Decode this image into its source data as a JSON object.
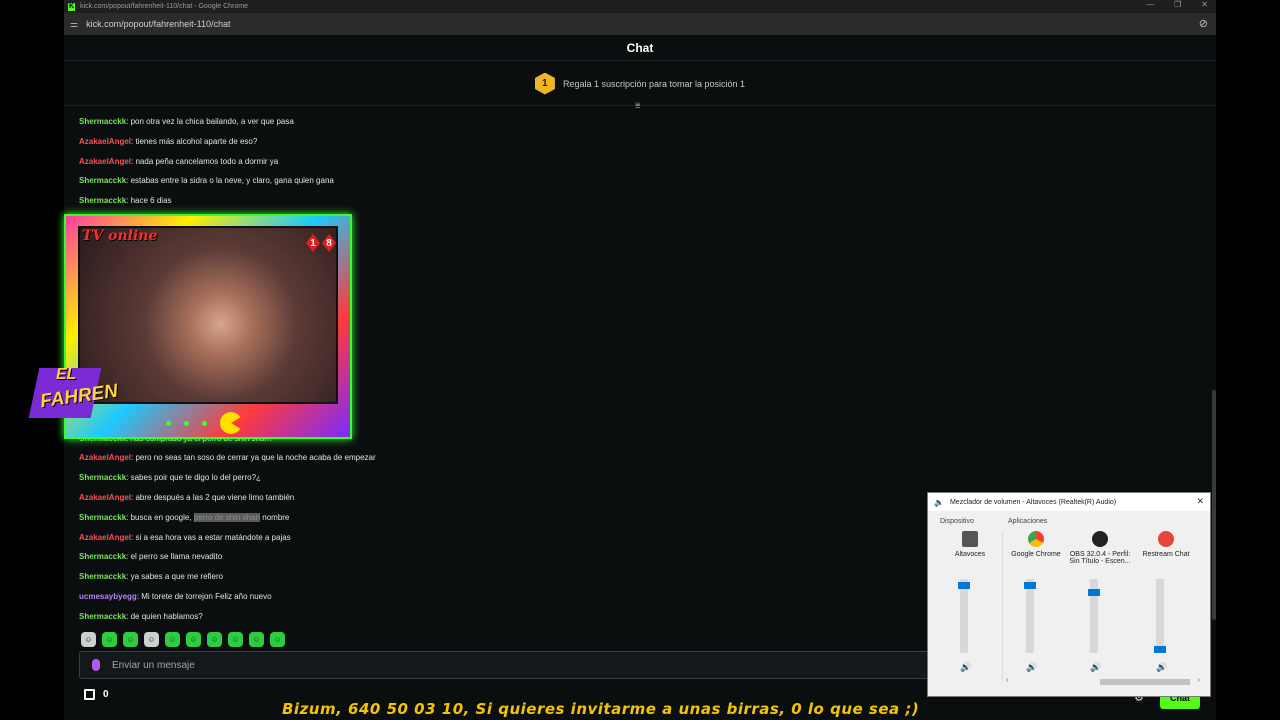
{
  "browser": {
    "window_title": "kick.com/popout/fahrenheit-110/chat - Google Chrome",
    "url": "kick.com/popout/fahrenheit-110/chat"
  },
  "chat": {
    "header": "Chat",
    "banner": {
      "badge": "1",
      "text": "Regala 1 suscripción para tomar la posición 1"
    },
    "colors": {
      "green_user": "#7ee05f",
      "red_user": "#f25555",
      "purple_user": "#b684f2",
      "accent": "#53fc18"
    },
    "messages": [
      {
        "user": "Shermacckk",
        "color": "green",
        "text": ": pon otra vez la chica bailando, a ver que pasa"
      },
      {
        "user": "AzakaelAngel",
        "color": "red",
        "text": ": tienes más alcohol aparte de eso?"
      },
      {
        "user": "AzakaelAngel",
        "color": "red",
        "text": ": nada peña cancelamos todo a dormir ya"
      },
      {
        "user": "Shermacckk",
        "color": "green",
        "text": ": estabas entre la sidra o la neve, y claro, gana quien gana"
      },
      {
        "user": "Shermacckk",
        "color": "green",
        "text": ": hace 6 dias"
      },
      {
        "user": "Shermacckk",
        "color": "green",
        "text": ": has comprado ya el perro de shin shan?"
      },
      {
        "user": "AzakaelAngel",
        "color": "red",
        "text": ": pero no seas tan soso de cerrar ya que la noche acaba de empezar"
      },
      {
        "user": "Shermacckk",
        "color": "green",
        "text": ": sabes poir que te digo lo del perro?¿"
      },
      {
        "user": "AzakaelAngel",
        "color": "red",
        "text": ": abre después a las 2 que viene limo también"
      },
      {
        "user": "Shermacckk",
        "color": "green",
        "text": ": busca en google, ",
        "highlight": "perro de shin shan",
        "after": " nombre"
      },
      {
        "user": "AzakaelAngel",
        "color": "red",
        "text": ": si a esa hora vas a estar matándote a pajas"
      },
      {
        "user": "Shermacckk",
        "color": "green",
        "text": ": el perro se llama nevadito"
      },
      {
        "user": "Shermacckk",
        "color": "green",
        "text": ": ya sabes a que me refiero"
      },
      {
        "user": "ucmesaybyegg",
        "color": "purple",
        "text": ": Mi torete de torrejon Feliz año nuevo"
      },
      {
        "user": "Shermacckk",
        "color": "green",
        "text": ": de quien hablamos?"
      }
    ],
    "input_placeholder": "Enviar un mensaje",
    "gift_count": "0",
    "chat_button": "Chat",
    "emotes": [
      "monkey-emote",
      "frog-emote",
      "frog-emote",
      "ghost-emote",
      "frog-emote",
      "frog-emote",
      "frog-emote",
      "frog-emote",
      "burger-emote",
      "frog-emote"
    ]
  },
  "overlay": {
    "cam_logo": "TV online",
    "age_rating": [
      "1",
      "8"
    ],
    "logo_top": "EL",
    "logo_bottom": "FAHREN"
  },
  "ticker": "Bizum, 640 50 03 10, Si quieres invitarme a unas birras, 0 lo que sea ;)",
  "mixer": {
    "title": "Mezclador de volumen - Altavoces (Realtek(R) Audio)",
    "device_label": "Dispositivo",
    "apps_label": "Aplicaciones",
    "channels": [
      {
        "name": "Altavoces",
        "level": 0.95,
        "icon": "speaker-device-icon"
      },
      {
        "name": "Google Chrome",
        "level": 0.95,
        "icon": "chrome-icon"
      },
      {
        "name": "OBS 32.0.4 - Perfil: Sin Título - Escen...",
        "level": 0.85,
        "icon": "obs-icon"
      },
      {
        "name": "Restream Chat",
        "level": 0.0,
        "icon": "restream-icon"
      }
    ]
  }
}
